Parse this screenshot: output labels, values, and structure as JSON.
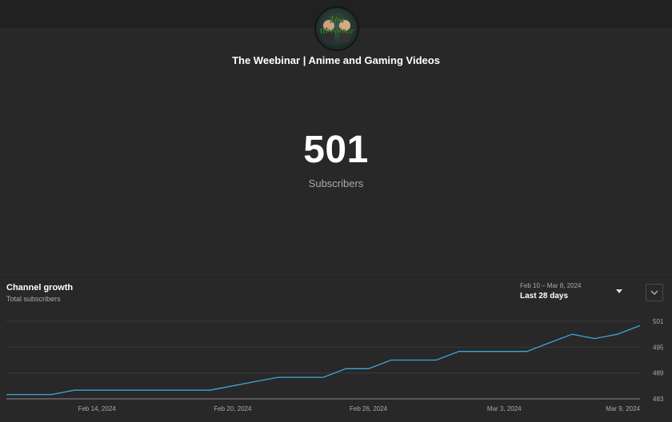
{
  "channel": {
    "name": "The Weebinar | Anime and Gaming Videos",
    "avatar_icon": "channel-avatar",
    "avatar_text_line1": "The",
    "avatar_text_line2": "Weebinar"
  },
  "subscribers": {
    "count": "501",
    "label": "Subscribers"
  },
  "growth": {
    "title": "Channel growth",
    "subtitle": "Total subscribers",
    "range_dates": "Feb 10 – Mar 8, 2024",
    "range_label": "Last 28 days"
  },
  "colors": {
    "line": "#3ea6d8",
    "background": "#282828",
    "topbar": "#212121"
  },
  "chart_data": {
    "type": "line",
    "x": [
      "Feb 10, 2024",
      "Feb 11, 2024",
      "Feb 12, 2024",
      "Feb 13, 2024",
      "Feb 14, 2024",
      "Feb 15, 2024",
      "Feb 16, 2024",
      "Feb 17, 2024",
      "Feb 18, 2024",
      "Feb 19, 2024",
      "Feb 20, 2024",
      "Feb 21, 2024",
      "Feb 22, 2024",
      "Feb 23, 2024",
      "Feb 24, 2024",
      "Feb 25, 2024",
      "Feb 26, 2024",
      "Feb 27, 2024",
      "Feb 28, 2024",
      "Feb 29, 2024",
      "Mar 1, 2024",
      "Mar 2, 2024",
      "Mar 3, 2024",
      "Mar 4, 2024",
      "Mar 5, 2024",
      "Mar 6, 2024",
      "Mar 7, 2024",
      "Mar 8, 2024",
      "Mar 9, 2024"
    ],
    "values": [
      484,
      484,
      484,
      485,
      485,
      485,
      485,
      485,
      485,
      485,
      486,
      487,
      488,
      488,
      488,
      490,
      490,
      492,
      492,
      492,
      494,
      494,
      494,
      494,
      496,
      498,
      497,
      498,
      500
    ],
    "x_tick_labels": [
      "Feb 14, 2024",
      "Feb 20, 2024",
      "Feb 26, 2024",
      "Mar 3, 2024",
      "Mar 9, 2024"
    ],
    "y_ticks": [
      483,
      489,
      495,
      501
    ],
    "ylim": [
      483,
      501
    ],
    "grid": true,
    "title": "Channel growth",
    "ylabel": "Total subscribers"
  }
}
